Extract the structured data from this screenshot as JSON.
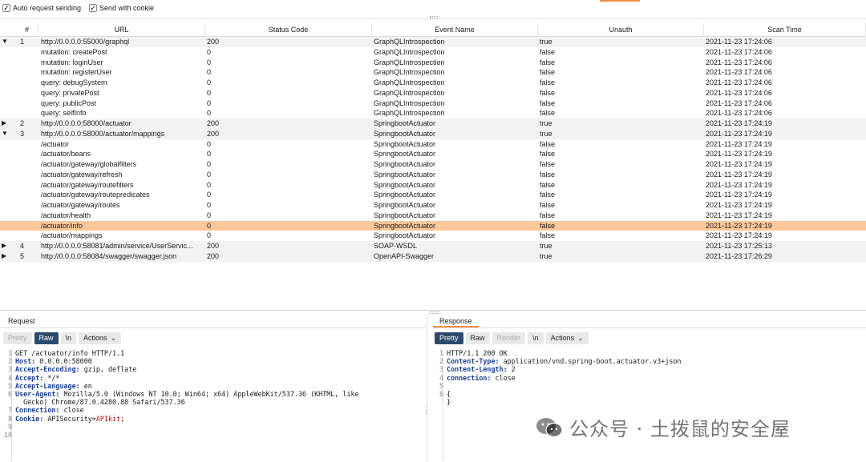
{
  "options": {
    "auto_request": {
      "label": "Auto request sending",
      "checked": true
    },
    "send_cookie": {
      "label": "Send with cookie",
      "checked": true
    }
  },
  "columns": [
    "#",
    "URL",
    "Status Code",
    "Event Name",
    "Unauth",
    "Scan Time"
  ],
  "rows": [
    {
      "toggle": "▼",
      "num": "1",
      "url": "http://0.0.0.0:55000/graphql",
      "status": "200",
      "event": "GraphQLIntrospection",
      "unauth": "true",
      "time": "2021-11-23 17:24:06",
      "kind": "parent"
    },
    {
      "toggle": "",
      "num": "",
      "url": "mutation: createPost",
      "status": "0",
      "event": "GraphQLIntrospection",
      "unauth": "false",
      "time": "2021-11-23 17:24:06",
      "kind": "child"
    },
    {
      "toggle": "",
      "num": "",
      "url": "mutation: loginUser",
      "status": "0",
      "event": "GraphQLIntrospection",
      "unauth": "false",
      "time": "2021-11-23 17:24:06",
      "kind": "child"
    },
    {
      "toggle": "",
      "num": "",
      "url": "mutation: registerUser",
      "status": "0",
      "event": "GraphQLIntrospection",
      "unauth": "false",
      "time": "2021-11-23 17:24:06",
      "kind": "child"
    },
    {
      "toggle": "",
      "num": "",
      "url": "query: debugSystem",
      "status": "0",
      "event": "GraphQLIntrospection",
      "unauth": "false",
      "time": "2021-11-23 17:24:06",
      "kind": "child"
    },
    {
      "toggle": "",
      "num": "",
      "url": "query: privatePost",
      "status": "0",
      "event": "GraphQLIntrospection",
      "unauth": "false",
      "time": "2021-11-23 17:24:06",
      "kind": "child"
    },
    {
      "toggle": "",
      "num": "",
      "url": "query: publicPost",
      "status": "0",
      "event": "GraphQLIntrospection",
      "unauth": "false",
      "time": "2021-11-23 17:24:06",
      "kind": "child"
    },
    {
      "toggle": "",
      "num": "",
      "url": "query: selfInfo",
      "status": "0",
      "event": "GraphQLIntrospection",
      "unauth": "false",
      "time": "2021-11-23 17:24:06",
      "kind": "child"
    },
    {
      "toggle": "▶",
      "num": "2",
      "url": "http://0.0.0.0:58000/actuator",
      "status": "200",
      "event": "SpringbootActuator",
      "unauth": "true",
      "time": "2021-11-23 17:24:19",
      "kind": "parent"
    },
    {
      "toggle": "▼",
      "num": "3",
      "url": "http://0.0.0.0:58000/actuator/mappings",
      "status": "200",
      "event": "SpringbootActuator",
      "unauth": "true",
      "time": "2021-11-23 17:24:19",
      "kind": "parent"
    },
    {
      "toggle": "",
      "num": "",
      "url": "/actuator",
      "status": "0",
      "event": "SpringbootActuator",
      "unauth": "false",
      "time": "2021-11-23 17:24:19",
      "kind": "child"
    },
    {
      "toggle": "",
      "num": "",
      "url": "/actuator/beans",
      "status": "0",
      "event": "SpringbootActuator",
      "unauth": "false",
      "time": "2021-11-23 17:24:19",
      "kind": "child"
    },
    {
      "toggle": "",
      "num": "",
      "url": "/actuator/gateway/globalfilters",
      "status": "0",
      "event": "SpringbootActuator",
      "unauth": "false",
      "time": "2021-11-23 17:24:19",
      "kind": "child"
    },
    {
      "toggle": "",
      "num": "",
      "url": "/actuator/gateway/refresh",
      "status": "0",
      "event": "SpringbootActuator",
      "unauth": "false",
      "time": "2021-11-23 17:24:19",
      "kind": "child"
    },
    {
      "toggle": "",
      "num": "",
      "url": "/actuator/gateway/routefilters",
      "status": "0",
      "event": "SpringbootActuator",
      "unauth": "false",
      "time": "2021-11-23 17:24:19",
      "kind": "child"
    },
    {
      "toggle": "",
      "num": "",
      "url": "/actuator/gateway/routepredicates",
      "status": "0",
      "event": "SpringbootActuator",
      "unauth": "false",
      "time": "2021-11-23 17:24:19",
      "kind": "child"
    },
    {
      "toggle": "",
      "num": "",
      "url": "/actuator/gateway/routes",
      "status": "0",
      "event": "SpringbootActuator",
      "unauth": "false",
      "time": "2021-11-23 17:24:19",
      "kind": "child"
    },
    {
      "toggle": "",
      "num": "",
      "url": "/actuator/health",
      "status": "0",
      "event": "SpringbootActuator",
      "unauth": "false",
      "time": "2021-11-23 17:24:19",
      "kind": "child"
    },
    {
      "toggle": "",
      "num": "",
      "url": "/actuator/info",
      "status": "0",
      "event": "SpringbootActuator",
      "unauth": "false",
      "time": "2021-11-23 17:24:19",
      "kind": "selected"
    },
    {
      "toggle": "",
      "num": "",
      "url": "/actuator/mappings",
      "status": "0",
      "event": "SpringbootActuator",
      "unauth": "false",
      "time": "2021-11-23 17:24:19",
      "kind": "child"
    },
    {
      "toggle": "▶",
      "num": "4",
      "url": "http://0.0.0.0:58081/admin/service/UserServic...",
      "status": "200",
      "event": "SOAP-WSDL",
      "unauth": "true",
      "time": "2021-11-23 17:25:13",
      "kind": "parent"
    },
    {
      "toggle": "▶",
      "num": "5",
      "url": "http://0.0.0.0:58084/swagger/swagger.json",
      "status": "200",
      "event": "OpenAPI-Swagger",
      "unauth": "true",
      "time": "2021-11-23 17:26:29",
      "kind": "parent"
    }
  ],
  "request": {
    "title": "Request",
    "buttons": {
      "pretty": "Pretty",
      "raw": "Raw",
      "newline": "\\n",
      "actions": "Actions"
    },
    "lines": [
      {
        "n": "1",
        "k": "",
        "v": "GET /actuator/info HTTP/1.1",
        "c": ""
      },
      {
        "n": "2",
        "k": "Host:",
        "v": " 0.0.0.0:58000",
        "c": ""
      },
      {
        "n": "3",
        "k": "Accept-Encoding:",
        "v": " gzip, deflate",
        "c": ""
      },
      {
        "n": "4",
        "k": "Accept:",
        "v": " */*",
        "c": ""
      },
      {
        "n": "5",
        "k": "Accept-Language:",
        "v": " en",
        "c": ""
      },
      {
        "n": "6",
        "k": "User-Agent:",
        "v": " Mozilla/5.0 (Windows NT 10.0; Win64; x64) AppleWebKit/537.36 (KHTML, like",
        "c": ""
      },
      {
        "n": "",
        "k": "",
        "v": "  Gecko) Chrome/87.0.4280.88 Safari/537.36",
        "c": ""
      },
      {
        "n": "7",
        "k": "Connection:",
        "v": " close",
        "c": ""
      },
      {
        "n": "8",
        "k": "Cookie:",
        "v": " APISecurity=",
        "c": "APIkit;"
      },
      {
        "n": "9",
        "k": "",
        "v": "",
        "c": ""
      },
      {
        "n": "10",
        "k": "",
        "v": "",
        "c": ""
      }
    ]
  },
  "response": {
    "title": "Response",
    "buttons": {
      "pretty": "Pretty",
      "raw": "Raw",
      "render": "Render",
      "newline": "\\n",
      "actions": "Actions"
    },
    "lines": [
      {
        "n": "1",
        "k": "",
        "v": "HTTP/1.1 200 OK"
      },
      {
        "n": "2",
        "k": "Content-Type:",
        "v": " application/vnd.spring-boot.actuator.v3+json"
      },
      {
        "n": "3",
        "k": "Content-Length:",
        "v": " 2"
      },
      {
        "n": "4",
        "k": "connection:",
        "v": " close"
      },
      {
        "n": "5",
        "k": "",
        "v": ""
      },
      {
        "n": "6",
        "k": "",
        "v": "{"
      },
      {
        "n": "",
        "k": "",
        "v": "}"
      }
    ]
  },
  "watermark": "公众号 · 土拨鼠的安全屋",
  "colors": {
    "selected_row": "#fbc89a",
    "accent": "#f08d3c",
    "header_key": "#1c3f9e"
  }
}
